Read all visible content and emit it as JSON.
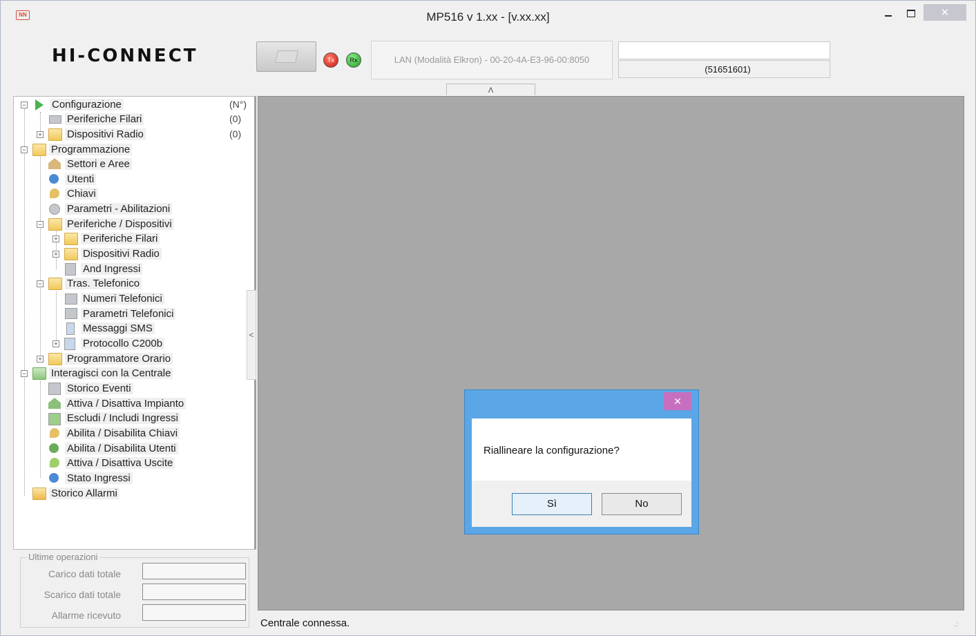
{
  "window": {
    "title": "MP516 v 1.xx -  [v.xx.xx]",
    "app_icon": "NN",
    "close_glyph": "✕"
  },
  "header": {
    "logo_text": "HI-CONNECT",
    "connection_info": "LAN (Modalità Elkron) - 00-20-4A-E3-96-00:8050",
    "tx_label": "Tx",
    "rx_label": "Rx",
    "field_top": "",
    "field_bottom": "(51651601)",
    "collapse_glyph": "Λ"
  },
  "tree": {
    "count_header": "(N°)",
    "items": [
      {
        "label": "Configurazione",
        "count": "(N°)"
      },
      {
        "label": "Periferiche Filari",
        "count": "(0)"
      },
      {
        "label": "Dispositivi Radio",
        "count": "(0)"
      },
      {
        "label": "Programmazione"
      },
      {
        "label": "Settori e Aree"
      },
      {
        "label": "Utenti"
      },
      {
        "label": "Chiavi"
      },
      {
        "label": "Parametri - Abilitazioni"
      },
      {
        "label": "Periferiche / Dispositivi"
      },
      {
        "label": "Periferiche Filari"
      },
      {
        "label": "Dispositivi Radio"
      },
      {
        "label": "And Ingressi"
      },
      {
        "label": "Tras. Telefonico"
      },
      {
        "label": "Numeri Telefonici"
      },
      {
        "label": "Parametri Telefonici"
      },
      {
        "label": "Messaggi SMS"
      },
      {
        "label": "Protocollo C200b"
      },
      {
        "label": "Programmatore Orario"
      },
      {
        "label": "Interagisci con la Centrale"
      },
      {
        "label": "Storico Eventi"
      },
      {
        "label": "Attiva / Disattiva Impianto"
      },
      {
        "label": "Escludi / Includi Ingressi"
      },
      {
        "label": "Abilita / Disabilita Chiavi"
      },
      {
        "label": "Abilita / Disabilita Utenti"
      },
      {
        "label": "Attiva / Disattiva Uscite"
      },
      {
        "label": "Stato Ingressi"
      },
      {
        "label": "Storico Allarmi"
      }
    ]
  },
  "splitter_glyph": "<",
  "ops": {
    "title": "Ultime operazioni",
    "rows": [
      {
        "label": "Carico dati totale",
        "value": ""
      },
      {
        "label": "Scarico dati totale",
        "value": ""
      },
      {
        "label": "Allarme ricevuto",
        "value": ""
      }
    ]
  },
  "status": {
    "text": "Centrale connessa.",
    "grip": ".:"
  },
  "dialog": {
    "message": "Riallineare la configurazione?",
    "yes_label": "Sì",
    "no_label": "No",
    "close_glyph": "✕"
  },
  "colors": {
    "window_bg": "#f0f0f0",
    "workspace_bg": "#a8a8a8",
    "dialog_frame": "#5aa6e6",
    "dialog_close": "#c76fbf"
  }
}
